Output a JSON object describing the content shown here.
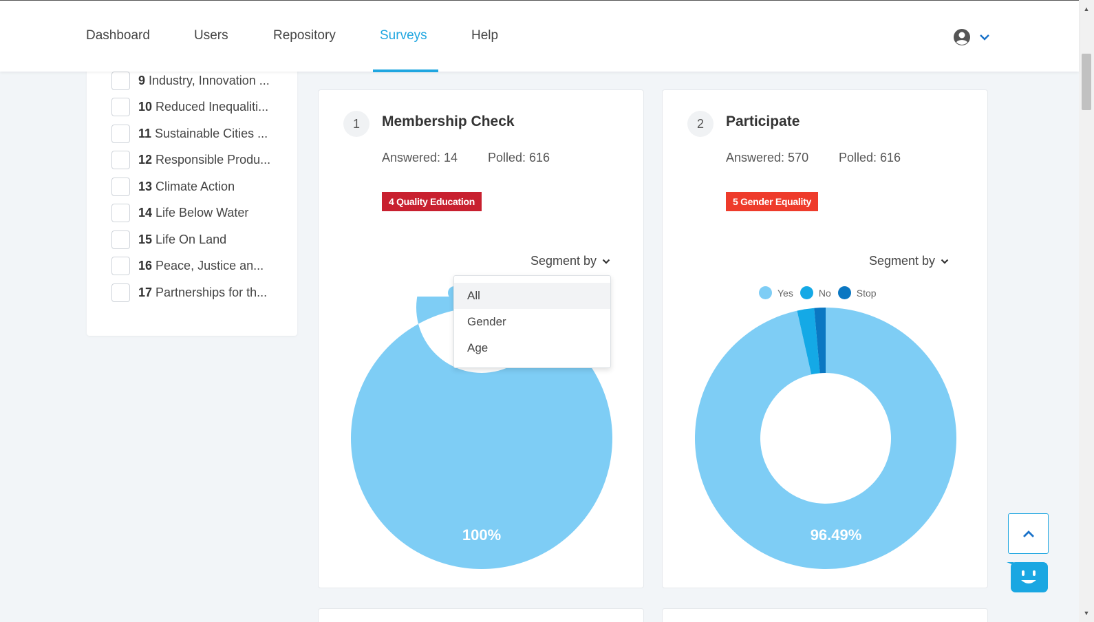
{
  "nav": {
    "items": [
      {
        "label": "Dashboard",
        "active": false
      },
      {
        "label": "Users",
        "active": false
      },
      {
        "label": "Repository",
        "active": false
      },
      {
        "label": "Surveys",
        "active": true
      },
      {
        "label": "Help",
        "active": false
      }
    ],
    "account_icon": "user-circle-icon",
    "account_chevron": "chevron-down-icon"
  },
  "filters": {
    "items": [
      {
        "num": "9",
        "label": "Industry, Innovation ..."
      },
      {
        "num": "10",
        "label": "Reduced Inequaliti..."
      },
      {
        "num": "11",
        "label": "Sustainable Cities ..."
      },
      {
        "num": "12",
        "label": "Responsible Produ..."
      },
      {
        "num": "13",
        "label": "Climate Action"
      },
      {
        "num": "14",
        "label": "Life Below Water"
      },
      {
        "num": "15",
        "label": "Life On Land"
      },
      {
        "num": "16",
        "label": "Peace, Justice an..."
      },
      {
        "num": "17",
        "label": "Partnerships for th..."
      }
    ]
  },
  "cards": [
    {
      "num": "1",
      "title": "Membership Check",
      "answered": "Answered: 14",
      "polled": "Polled: 616",
      "tag": "4 Quality Education",
      "tag_color": "#c8202f",
      "segment_label": "Segment by",
      "chart_center_label": "100%"
    },
    {
      "num": "2",
      "title": "Participate",
      "answered": "Answered: 570",
      "polled": "Polled: 616",
      "tag": "5 Gender Equality",
      "tag_color": "#ee3b2b",
      "segment_label": "Segment by",
      "chart_center_label": "96.49%",
      "legend": [
        "Yes",
        "No",
        "Stop"
      ]
    }
  ],
  "dropdown": {
    "options": [
      "All",
      "Gender",
      "Age"
    ],
    "selected": "All"
  },
  "chart_data": [
    {
      "type": "pie",
      "categories": [
        "Yes"
      ],
      "values": [
        14
      ],
      "colors": [
        "#7ecdf5"
      ],
      "data_labels": [
        "100%"
      ]
    },
    {
      "type": "pie",
      "categories": [
        "Yes",
        "No",
        "Stop"
      ],
      "values": [
        550,
        12,
        8
      ],
      "colors": [
        "#7ecdf5",
        "#14a9e6",
        "#0a77c2"
      ],
      "data_labels": [
        "96.49%"
      ],
      "legend": "top"
    }
  ],
  "colors": {
    "accent": "#1fa6e0",
    "yes": "#7ecdf5",
    "no": "#14a9e6",
    "stop": "#0a77c2"
  },
  "floating": {
    "back_to_top_icon": "chevron-up-icon",
    "chat_icon": "chat-bot-icon"
  }
}
